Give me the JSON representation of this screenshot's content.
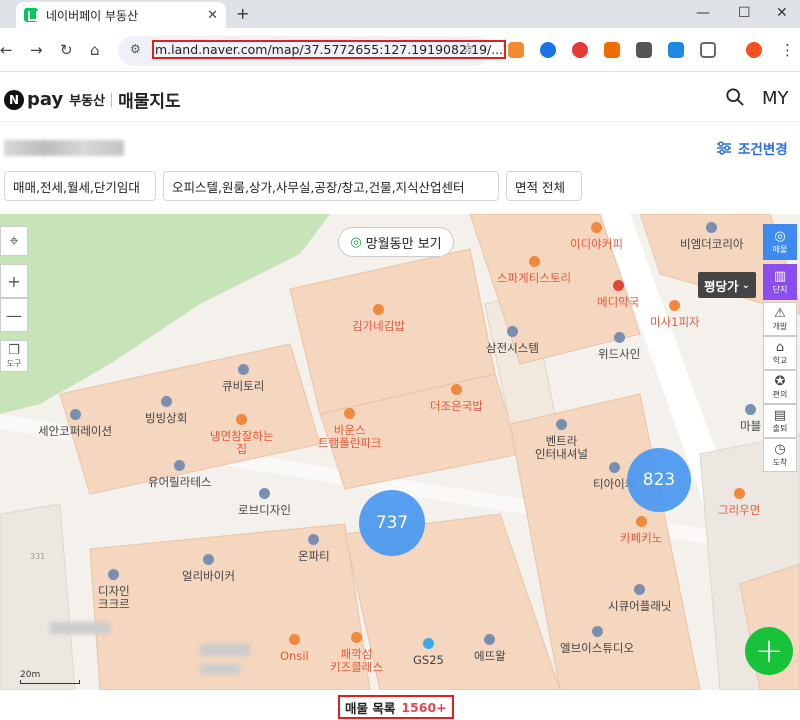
{
  "browser": {
    "tab_title": "네이버페이 부동산",
    "url": "m.land.naver.com/map/37.5772655:127.1919082:19/..."
  },
  "app": {
    "brand_n": "N",
    "brand_pay": "pay",
    "brand_realty": "부동산",
    "title": "매물지도",
    "my_label": "MY"
  },
  "location": {
    "condition_label": "조건변경"
  },
  "filters": [
    "매매,전세,월세,단기임대",
    "오피스텔,원룸,상가,사무실,공장/창고,건물,지식산업센터",
    "면적 전체"
  ],
  "map": {
    "view_only_label": "망월동만 보기",
    "tool_label": "도구",
    "price_tip": "평당가",
    "scale_label": "20m",
    "clusters": [
      {
        "count": "737"
      },
      {
        "count": "823"
      }
    ],
    "poi": {
      "p1": "이디야커피",
      "p2": "비엠더코리아",
      "p3": "스파게티스토리",
      "p4": "메디약국",
      "p5": "미사1피자",
      "p6": "김가네김밥",
      "p7": "삼전시스템",
      "p8": "위드사인",
      "p9": "큐비토리",
      "p10": "빙빙상회",
      "p11": "세안코퍼레이션",
      "p12": "냉면참잘하는\n집",
      "p13": "바운스\n트램폴린파크",
      "p14": "더조은국밥",
      "p15": "벤트라\n인터내셔널",
      "p16": "마블",
      "p17": "유어릴라테스",
      "p18": "티아이케",
      "p19": "로브디자인",
      "p20": "그리우면",
      "p21": "카페키노",
      "p22": "온파티",
      "p23": "얼리바이커",
      "p24": "디자인\n크크르",
      "p25": "시큐어플래닛",
      "p26": "Onsil",
      "p27": "패깍섬\n키즈클래스",
      "p28": "GS25",
      "p29": "에뜨왈",
      "p30": "엘브이스튜디오",
      "p31": "331"
    }
  },
  "rail": [
    "매물",
    "단지",
    "개발",
    "학교",
    "편의",
    "출퇴",
    "도착"
  ],
  "footer": {
    "list_label": "매물 목록",
    "count": "1560+"
  },
  "colors": {
    "accent": "#2a6fdb",
    "cluster": "#4e9af1",
    "fab": "#18c23a",
    "building": "#f5d6bf",
    "park": "#c7e4b8",
    "highlight": "#e02020"
  }
}
